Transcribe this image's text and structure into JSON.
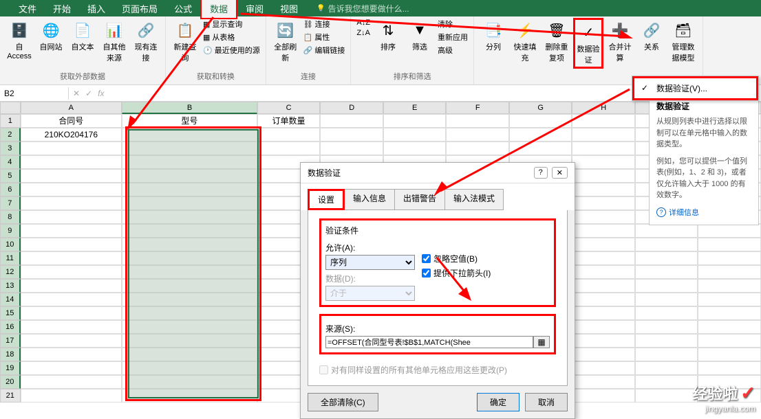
{
  "tabs": {
    "file": "文件",
    "home": "开始",
    "insert": "插入",
    "pageLayout": "页面布局",
    "formulas": "公式",
    "data": "数据",
    "review": "审阅",
    "view": "视图",
    "tellMe": "告诉我您想要做什么..."
  },
  "ribbon": {
    "access": "自 Access",
    "web": "自网站",
    "text": "自文本",
    "other": "自其他来源",
    "existing": "现有连接",
    "externalData": "获取外部数据",
    "newQuery": "新建查询",
    "showQuery": "显示查询",
    "fromTable": "从表格",
    "recentSources": "最近使用的源",
    "getTransform": "获取和转换",
    "refreshAll": "全部刷新",
    "connections": "连接",
    "properties": "属性",
    "editLinks": "编辑链接",
    "connectionsGroup": "连接",
    "sortAZ": "A↓Z",
    "sortZA": "Z↓A",
    "sort": "排序",
    "filter": "筛选",
    "clear": "清除",
    "reapply": "重新应用",
    "advanced": "高级",
    "sortFilter": "排序和筛选",
    "textToColumns": "分列",
    "flashFill": "快速填充",
    "removeDuplicates": "删除重复项",
    "dataValidation": "数据验证",
    "consolidate": "合并计算",
    "relationships": "关系",
    "dataModel": "管理数据模型"
  },
  "dropdown": {
    "dataValidation": "数据验证(V)..."
  },
  "tooltip": {
    "title": "数据验证",
    "text1": "从规则列表中进行选择以限制可以在单元格中输入的数据类型。",
    "text2": "例如，您可以提供一个值列表(例如，1、2 和 3)，或者仅允许输入大于 1000 的有效数字。",
    "link": "详细信息"
  },
  "nameBox": "B2",
  "sheet": {
    "headerA": "合同号",
    "headerB": "型号",
    "headerC": "订单数量",
    "a2": "210KO204176"
  },
  "dialog": {
    "title": "数据验证",
    "tabs": {
      "settings": "设置",
      "input": "输入信息",
      "error": "出错警告",
      "ime": "输入法模式"
    },
    "condition": "验证条件",
    "allow": "允许(A):",
    "allowValue": "序列",
    "data": "数据(D):",
    "between": "介于",
    "ignoreBlank": "忽略空值(B)",
    "dropdown": "提供下拉箭头(I)",
    "source": "来源(S):",
    "sourceValue": "=OFFSET(合同型号表!$B$1,MATCH(Shee",
    "applyAll": "对有同样设置的所有其他单元格应用这些更改(P)",
    "clearAll": "全部清除(C)",
    "ok": "确定",
    "cancel": "取消"
  },
  "watermark": {
    "main": "经验啦",
    "sub": "jingyanla.com"
  }
}
